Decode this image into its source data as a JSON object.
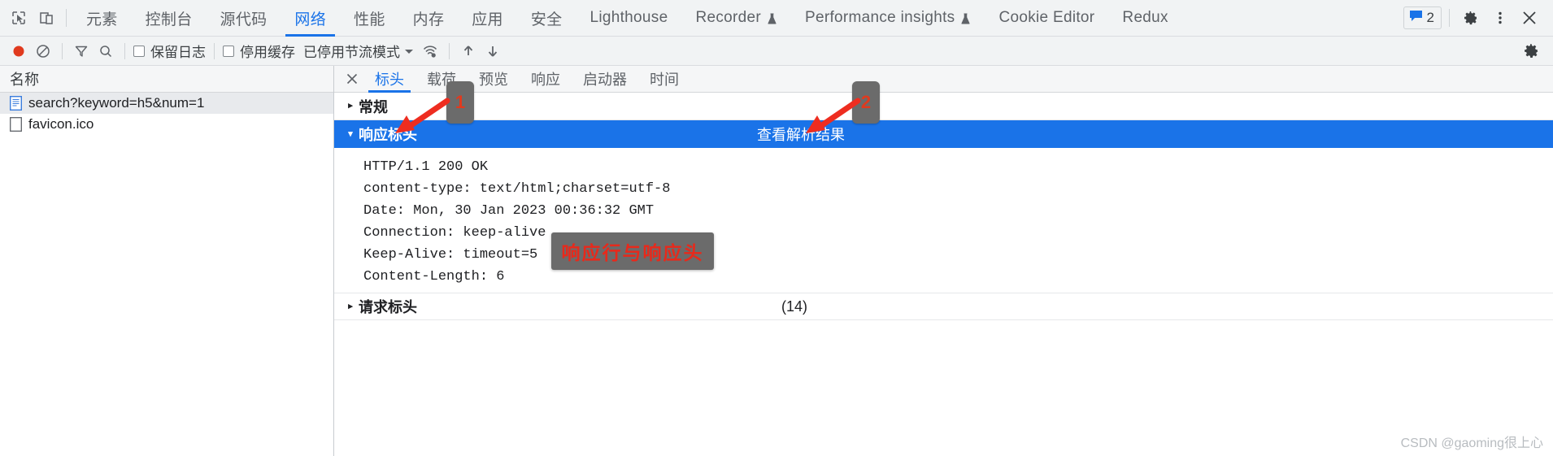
{
  "devtools": {
    "top_tabs": [
      {
        "label": "元素",
        "active": false,
        "flask": false
      },
      {
        "label": "控制台",
        "active": false,
        "flask": false
      },
      {
        "label": "源代码",
        "active": false,
        "flask": false
      },
      {
        "label": "网络",
        "active": true,
        "flask": false
      },
      {
        "label": "性能",
        "active": false,
        "flask": false
      },
      {
        "label": "内存",
        "active": false,
        "flask": false
      },
      {
        "label": "应用",
        "active": false,
        "flask": false
      },
      {
        "label": "安全",
        "active": false,
        "flask": false
      },
      {
        "label": "Lighthouse",
        "active": false,
        "flask": false
      },
      {
        "label": "Recorder",
        "active": false,
        "flask": true
      },
      {
        "label": "Performance insights",
        "active": false,
        "flask": true
      },
      {
        "label": "Cookie Editor",
        "active": false,
        "flask": false
      },
      {
        "label": "Redux",
        "active": false,
        "flask": false
      }
    ],
    "inspect_icon": "inspect-element-icon",
    "device_icon": "device-toolbar-icon",
    "message_count": "2",
    "settings_icon": "gear-icon",
    "more_icon": "more-vertical-icon",
    "close_icon": "close-icon"
  },
  "network_toolbar": {
    "record_icon": "record-icon",
    "clear_icon": "clear-icon",
    "filter_icon": "filter-icon",
    "search_icon": "search-icon",
    "preserve_log_label": "保留日志",
    "disable_cache_label": "停用缓存",
    "throttling_label": "已停用节流模式",
    "throttling_caret": "caret-down-icon",
    "wifi_icon": "network-conditions-icon",
    "import_icon": "upload-har-icon",
    "export_icon": "download-har-icon",
    "settings_icon": "gear-icon"
  },
  "requests": {
    "header": "名称",
    "rows": [
      {
        "name": "search?keyword=h5&num=1",
        "icon": "document-icon",
        "selected": true
      },
      {
        "name": "favicon.ico",
        "icon": "file-icon",
        "selected": false
      }
    ]
  },
  "detail": {
    "close_label": "×",
    "tabs": [
      {
        "label": "标头",
        "active": true
      },
      {
        "label": "载荷",
        "active": false
      },
      {
        "label": "预览",
        "active": false
      },
      {
        "label": "响应",
        "active": false
      },
      {
        "label": "启动器",
        "active": false
      },
      {
        "label": "时间",
        "active": false
      }
    ],
    "sections": [
      {
        "title": "常规",
        "triangle": "▸",
        "selected": false,
        "extra": "",
        "count": ""
      },
      {
        "title": "响应标头",
        "triangle": "▾",
        "selected": true,
        "extra": "查看解析结果",
        "count": ""
      }
    ],
    "response_headers": [
      "HTTP/1.1 200 OK",
      "content-type: text/html;charset=utf-8",
      "Date: Mon, 30 Jan 2023 00:36:32 GMT",
      "Connection: keep-alive",
      "Keep-Alive: timeout=5",
      "Content-Length: 6"
    ],
    "request_headers_section": {
      "title": "请求标头",
      "triangle": "▸",
      "count": "(14)"
    }
  },
  "annotations": {
    "badge_1": "1",
    "badge_2": "2",
    "note": "响应行与响应头"
  },
  "watermark": "CSDN @gaoming很上心"
}
